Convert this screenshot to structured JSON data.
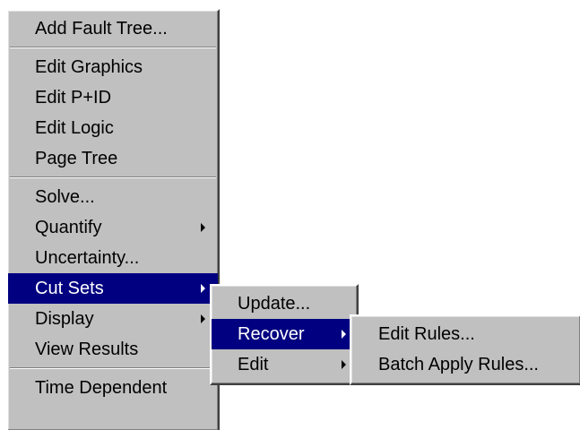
{
  "main_menu": {
    "items": [
      {
        "label": "Add Fault Tree...",
        "has_submenu": false,
        "selected": false
      },
      {
        "label": "Edit Graphics",
        "has_submenu": false,
        "selected": false
      },
      {
        "label": "Edit P+ID",
        "has_submenu": false,
        "selected": false
      },
      {
        "label": "Edit Logic",
        "has_submenu": false,
        "selected": false
      },
      {
        "label": "Page Tree",
        "has_submenu": false,
        "selected": false
      },
      {
        "label": "Solve...",
        "has_submenu": false,
        "selected": false
      },
      {
        "label": "Quantify",
        "has_submenu": true,
        "selected": false
      },
      {
        "label": "Uncertainty...",
        "has_submenu": false,
        "selected": false
      },
      {
        "label": "Cut Sets",
        "has_submenu": true,
        "selected": true
      },
      {
        "label": "Display",
        "has_submenu": true,
        "selected": false
      },
      {
        "label": "View Results",
        "has_submenu": false,
        "selected": false
      },
      {
        "label": "Time Dependent",
        "has_submenu": false,
        "selected": false
      }
    ]
  },
  "cutsets_submenu": {
    "items": [
      {
        "label": "Update...",
        "has_submenu": false,
        "selected": false
      },
      {
        "label": "Recover",
        "has_submenu": true,
        "selected": true
      },
      {
        "label": "Edit",
        "has_submenu": true,
        "selected": false
      }
    ]
  },
  "recover_submenu": {
    "items": [
      {
        "label": "Edit Rules...",
        "has_submenu": false,
        "selected": false
      },
      {
        "label": "Batch Apply Rules...",
        "has_submenu": false,
        "selected": false
      }
    ]
  },
  "colors": {
    "menu_face": "#c0c0c0",
    "selection": "#000080",
    "selection_text": "#ffffff"
  }
}
